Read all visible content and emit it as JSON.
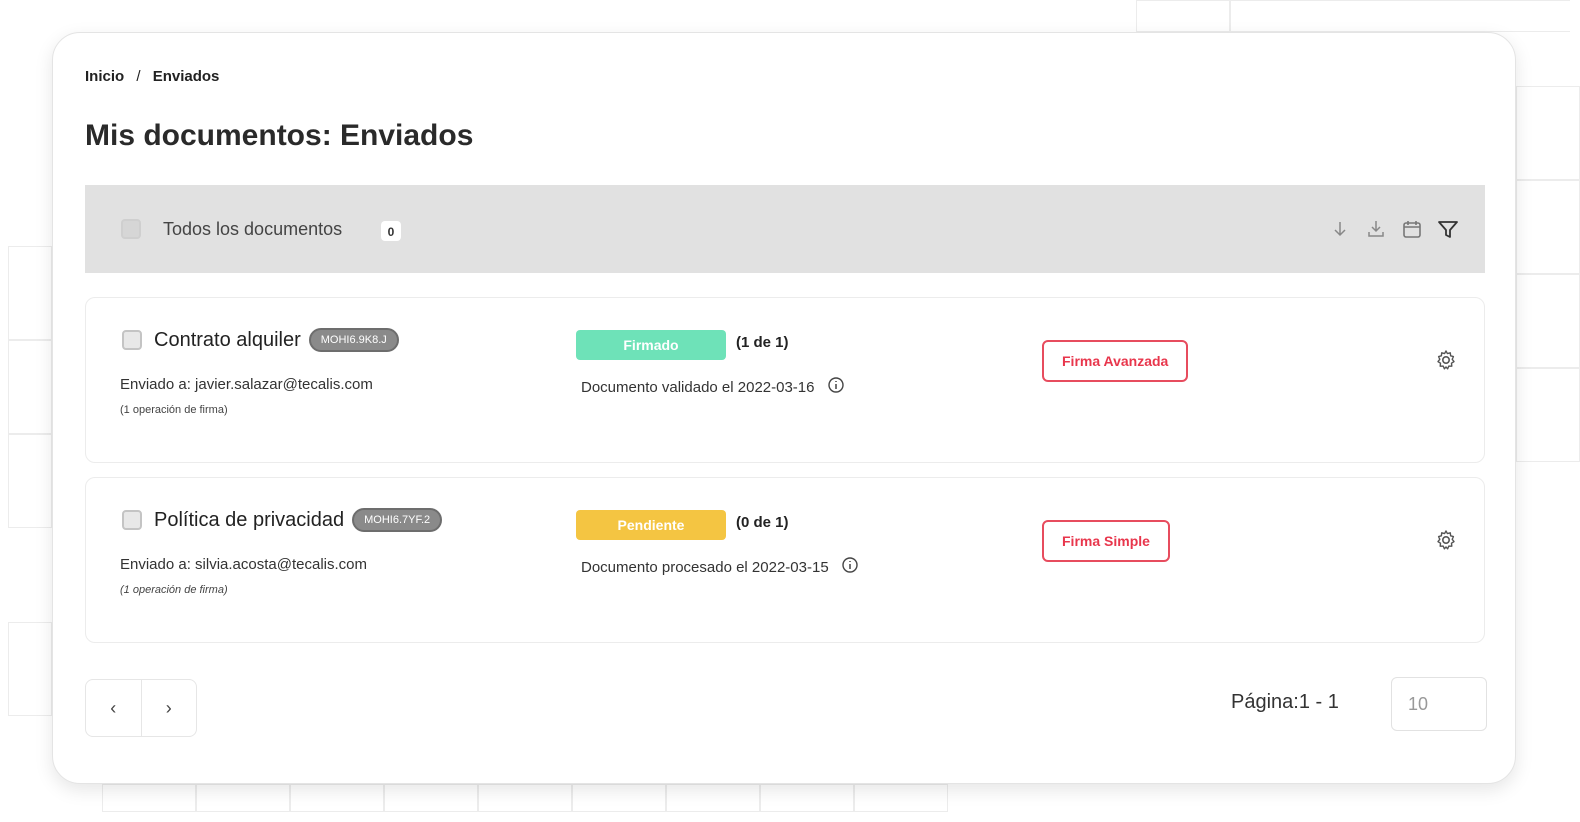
{
  "breadcrumb": {
    "home": "Inicio",
    "separator": "/",
    "current": "Enviados"
  },
  "page_title": "Mis documentos: Enviados",
  "toolbar": {
    "select_all_label": "Todos los documentos",
    "count": "0",
    "icons": [
      "sort-down-icon",
      "download-icon",
      "calendar-icon",
      "filter-icon"
    ]
  },
  "documents": [
    {
      "title": "Contrato alquiler",
      "code": "MOHI6.9K8.J",
      "sent_to": "Enviado a: javier.salazar@tecalis.com",
      "operations": "(1 operación de firma)",
      "status": "Firmado",
      "status_color": "#6ee2b8",
      "status_count": "(1 de 1)",
      "status_detail": "Documento validado el 2022-03-16",
      "signature_type": "Firma Avanzada"
    },
    {
      "title": "Política de privacidad",
      "code": "MOHI6.7YF.2",
      "sent_to": "Enviado a: silvia.acosta@tecalis.com",
      "operations": "(1 operación de firma)",
      "status": "Pendiente",
      "status_color": "#f4c542",
      "status_count": "(0 de 1)",
      "status_detail": "Documento procesado el 2022-03-15",
      "signature_type": "Firma Simple"
    }
  ],
  "pagination": {
    "prev": "‹",
    "next": "›",
    "page_info": "Página:1 - 1",
    "page_size": "10"
  }
}
